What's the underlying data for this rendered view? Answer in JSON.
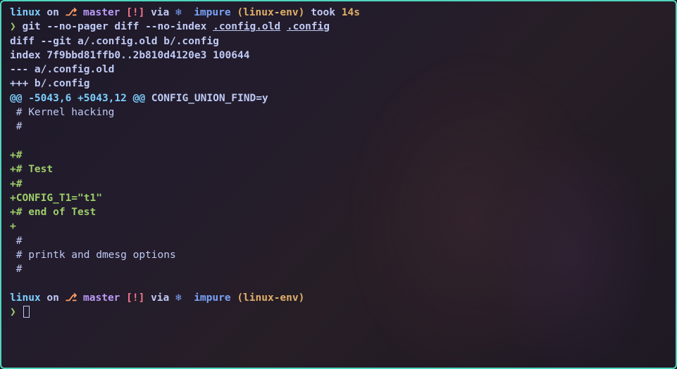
{
  "prompt1": {
    "dir": "linux",
    "on": " on ",
    "branch_icon": "⎇",
    "branch": " master ",
    "status": "[!]",
    "via": " via ",
    "via_icon": "❄ ",
    "impure": " impure ",
    "env": "(linux-env)",
    "took": " took ",
    "duration": "14s"
  },
  "cmd_line": {
    "prompt": "❯ ",
    "cmd": "git --no-pager diff --no-index ",
    "arg1": ".config.old",
    "space": " ",
    "arg2": ".config"
  },
  "diff": {
    "l1": "diff --git a/.config.old b/.config",
    "l2": "index 7f9bbd81ffb0..2b810d4120e3 100644",
    "l3": "--- a/.config.old",
    "l4": "+++ b/.config",
    "hunk_a": "@@ -5043,6 +5043,12 @@",
    "hunk_b": " CONFIG_UNION_FIND=y",
    "c1": " # Kernel hacking",
    "c2": " #",
    "blank1": " ",
    "a1": "+#",
    "a2": "+# Test",
    "a3": "+#",
    "a4": "+CONFIG_T1=\"t1\"",
    "a5": "+# end of Test",
    "a6": "+",
    "c3": " #",
    "c4": " # printk and dmesg options",
    "c5": " #",
    "blank2": " "
  },
  "prompt2": {
    "dir": "linux",
    "on": " on ",
    "branch_icon": "⎇",
    "branch": " master ",
    "status": "[!]",
    "via": " via ",
    "via_icon": "❄ ",
    "impure": " impure ",
    "env": "(linux-env)"
  },
  "prompt2_char": "❯ "
}
